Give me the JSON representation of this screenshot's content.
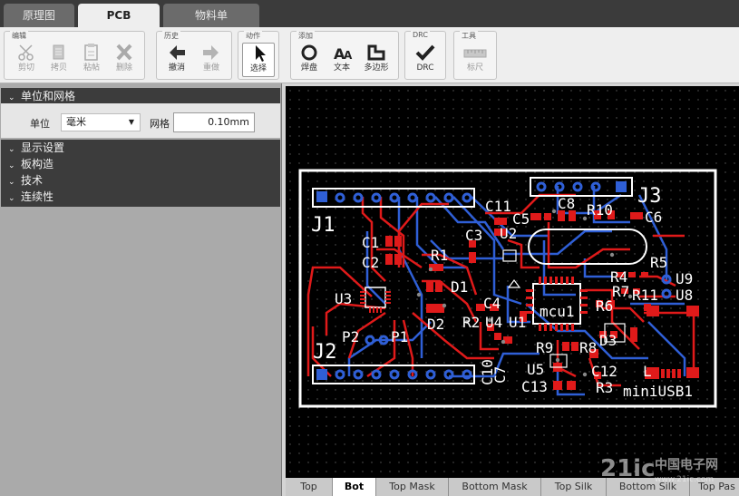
{
  "tabs": [
    {
      "label": "原理图",
      "active": false
    },
    {
      "label": "PCB",
      "active": true
    },
    {
      "label": "物料单",
      "active": false
    }
  ],
  "toolbar": {
    "groups": {
      "edit": "编辑",
      "history": "历史",
      "action": "动作",
      "add": "添加",
      "drc": "DRC",
      "tools": "工具"
    },
    "buttons": {
      "cut": "剪切",
      "copy": "拷贝",
      "paste": "粘帖",
      "delete": "删除",
      "undo": "撤消",
      "redo": "重做",
      "select": "选择",
      "pad": "焊盘",
      "text": "文本",
      "polygon": "多边形",
      "drc": "DRC",
      "ruler": "标尺"
    }
  },
  "panel": {
    "units_section": "单位和网格",
    "unit_label": "单位",
    "unit_value": "毫米",
    "grid_label": "网格",
    "grid_value": "0.10mm",
    "sections": [
      "显示设置",
      "板构造",
      "技术",
      "连续性"
    ]
  },
  "pcb": {
    "labels": [
      "J1",
      "J2",
      "J3",
      "U2",
      "U3",
      "U4",
      "U1",
      "U5",
      "U8",
      "U9",
      "C1",
      "C2",
      "C3",
      "C4",
      "C5",
      "C6",
      "C7",
      "C8",
      "C10",
      "C11",
      "C12",
      "C13",
      "R1",
      "R2",
      "R3",
      "R4",
      "R5",
      "R6",
      "R7",
      "R8",
      "R9",
      "R10",
      "R11",
      "D1",
      "D2",
      "D3",
      "P1",
      "P2",
      "L",
      "miniUSB1",
      "mcu1"
    ]
  },
  "layers": [
    {
      "label": "Top",
      "active": false
    },
    {
      "label": "Bot",
      "active": true
    },
    {
      "label": "Top Mask",
      "active": false
    },
    {
      "label": "Bottom Mask",
      "active": false
    },
    {
      "label": "Top Silk",
      "active": false
    },
    {
      "label": "Bottom Silk",
      "active": false
    },
    {
      "label": "Top Pas",
      "active": false
    }
  ],
  "watermark": {
    "logo": "21ic",
    "site": "中国电子网",
    "url": "www.21ic.com"
  },
  "colors": {
    "copper_top": "#e01a1a",
    "copper_bottom": "#2f5fd6",
    "silk": "#ffffff",
    "canvas": "#000000"
  }
}
